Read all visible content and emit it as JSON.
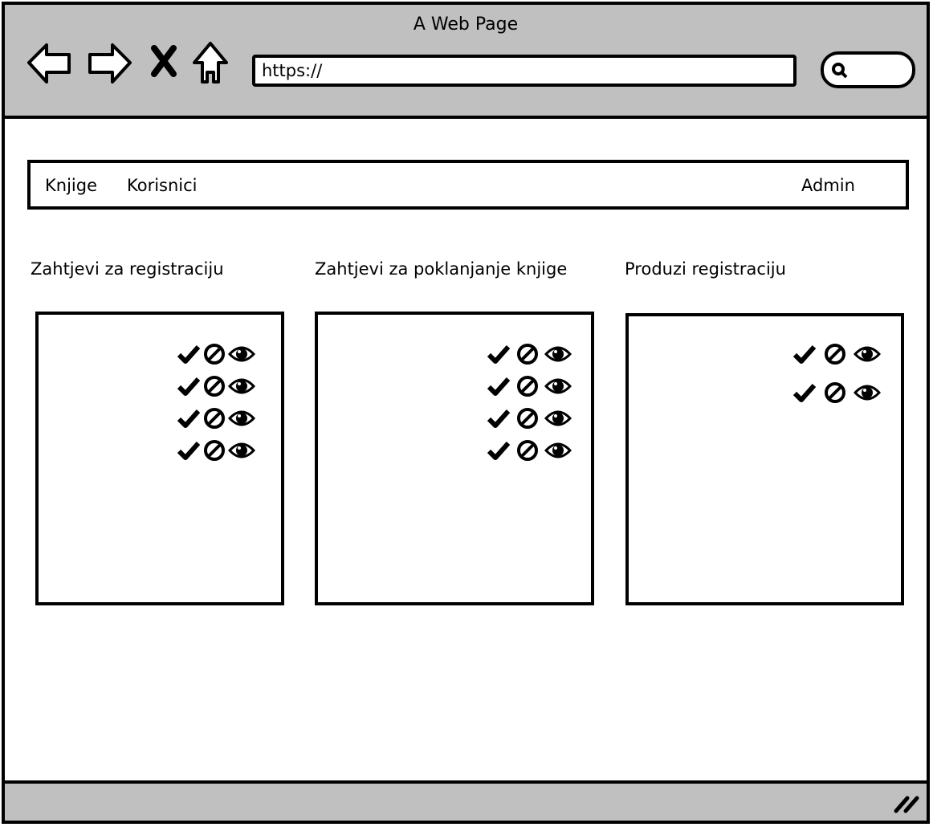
{
  "browser": {
    "title": "A Web Page",
    "url": "https://",
    "nav_icons": [
      "back-arrow-icon",
      "forward-arrow-icon",
      "close-x-icon",
      "home-icon"
    ],
    "search_icon": "search-icon"
  },
  "menu": {
    "items": [
      {
        "label": "Knjige"
      },
      {
        "label": "Korisnici"
      }
    ],
    "user": "Admin"
  },
  "panels": [
    {
      "title": "Zahtjevi za registraciju",
      "rows": [
        [
          "check-icon",
          "ban-icon",
          "eye-icon"
        ],
        [
          "check-icon",
          "ban-icon",
          "eye-icon"
        ],
        [
          "check-icon",
          "ban-icon",
          "eye-icon"
        ],
        [
          "check-icon",
          "ban-icon",
          "eye-icon"
        ]
      ]
    },
    {
      "title": "Zahtjevi za poklanjanje knjige",
      "rows": [
        [
          "check-icon",
          "ban-icon",
          "eye-icon"
        ],
        [
          "check-icon",
          "ban-icon",
          "eye-icon"
        ],
        [
          "check-icon",
          "ban-icon",
          "eye-icon"
        ],
        [
          "check-icon",
          "ban-icon",
          "eye-icon"
        ]
      ]
    },
    {
      "title": "Produzi registraciju",
      "rows": [
        [
          "check-icon",
          "ban-icon",
          "eye-icon"
        ],
        [
          "check-icon",
          "ban-icon",
          "eye-icon"
        ]
      ]
    }
  ]
}
